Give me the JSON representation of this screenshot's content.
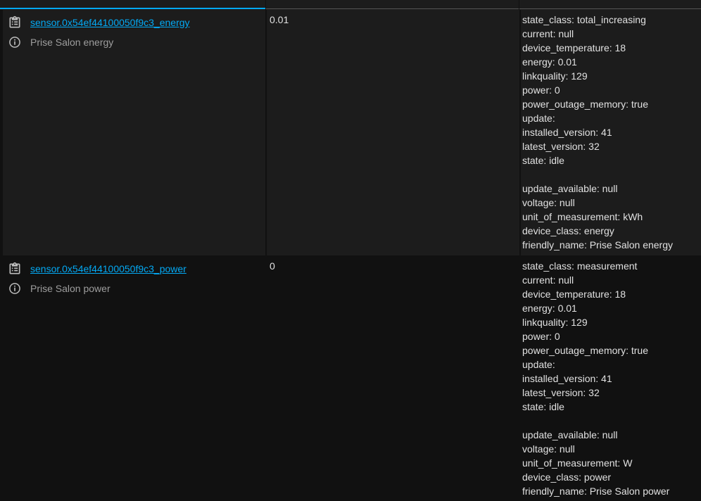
{
  "rows": [
    {
      "entity_id": "sensor.0x54ef44100050f9c3_energy",
      "friendly_name": "Prise Salon energy",
      "state": "0.01",
      "attributes": [
        "state_class: total_increasing",
        "current: null",
        "device_temperature: 18",
        "energy: 0.01",
        "linkquality: 129",
        "power: 0",
        "power_outage_memory: true",
        "update:",
        "installed_version: 41",
        "latest_version: 32",
        "state: idle",
        "",
        "update_available: null",
        "voltage: null",
        "unit_of_measurement: kWh",
        "device_class: energy",
        "friendly_name: Prise Salon energy"
      ]
    },
    {
      "entity_id": "sensor.0x54ef44100050f9c3_power",
      "friendly_name": "Prise Salon power",
      "state": "0",
      "attributes": [
        "state_class: measurement",
        "current: null",
        "device_temperature: 18",
        "energy: 0.01",
        "linkquality: 129",
        "power: 0",
        "power_outage_memory: true",
        "update:",
        "installed_version: 41",
        "latest_version: 32",
        "state: idle",
        "",
        "update_available: null",
        "voltage: null",
        "unit_of_measurement: W",
        "device_class: power",
        "friendly_name: Prise Salon power"
      ]
    }
  ],
  "colors": {
    "accent": "#03a9f4",
    "secondary_text": "#9e9e9e",
    "primary_text": "#e1e1e1",
    "row_bg_odd": "#1c1c1c",
    "row_bg_even": "#111111"
  },
  "icons": {
    "copy": "clipboard-list-icon",
    "info": "info-circle-icon"
  }
}
